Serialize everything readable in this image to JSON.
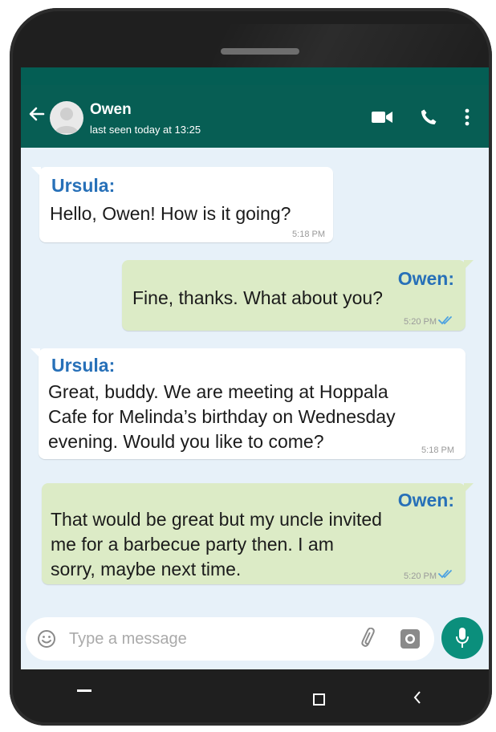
{
  "header": {
    "contact_name": "Owen",
    "last_seen": "last seen today at 13:25",
    "icons": [
      "back-arrow-icon",
      "avatar",
      "video-call-icon",
      "phone-icon",
      "more-vert-icon"
    ]
  },
  "messages": [
    {
      "direction": "incoming",
      "sender": "Ursula:",
      "lines": [
        "Hello, Owen! How is it going?"
      ],
      "time": "5:18 PM"
    },
    {
      "direction": "outgoing",
      "sender": "Owen:",
      "lines": [
        "Fine, thanks. What about you?"
      ],
      "time": "5:20 PM",
      "status": "read-double-tick"
    },
    {
      "direction": "incoming",
      "sender": "Ursula:",
      "lines": [
        "Great, buddy. We are meeting at Hoppala",
        "Cafe for Melinda’s birthday on Wednesday",
        "evening. Would you like to come?"
      ],
      "time": "5:18 PM"
    },
    {
      "direction": "outgoing",
      "sender": "Owen:",
      "lines": [
        "That would be great but my uncle invited",
        "me for a barbecue party then. I am",
        "sorry, maybe next time."
      ],
      "time": "5:20 PM",
      "status": "read-double-tick"
    }
  ],
  "composer": {
    "placeholder": "Type a message",
    "icons": [
      "emoji-icon",
      "attach-icon",
      "camera-icon",
      "mic-icon"
    ]
  },
  "colors": {
    "header": "#075e54",
    "chat_background": "#e7f1f9",
    "outgoing_bubble": "#dcebc6",
    "incoming_bubble": "#ffffff",
    "sender_name": "#2770b8",
    "read_ticks": "#4fa3e0",
    "mic_button": "#0b8f7c"
  }
}
